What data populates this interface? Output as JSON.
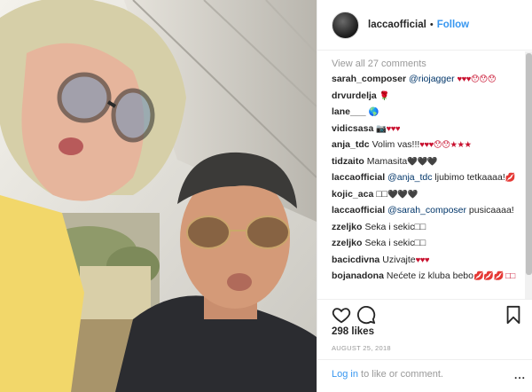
{
  "post": {
    "username": "laccaofficial",
    "separator": "•",
    "follow_label": "Follow",
    "view_all": "View all 27 comments",
    "likes": "298 likes",
    "date": "AUGUST 25, 2018",
    "login_link": "Log in",
    "login_rest": " to like or comment.",
    "more_label": "..."
  },
  "comments": [
    {
      "user": "sarah_composer",
      "mention": "@riojagger",
      "text": "",
      "emoji": "♥♥♥😯😯😯"
    },
    {
      "user": "drvurdelja",
      "mention": "",
      "text": "",
      "emoji": "🌹"
    },
    {
      "user": "lane___",
      "mention": "",
      "text": "",
      "emoji": "🌎"
    },
    {
      "user": "vidicsasa",
      "mention": "",
      "text": "",
      "emoji": "📷♥♥♥"
    },
    {
      "user": "anja_tdc",
      "mention": "",
      "text": "Volim vas!!!",
      "emoji": "♥♥♥😯😯★★★"
    },
    {
      "user": "tidzaito",
      "mention": "",
      "text": "Mamasita",
      "emoji": "🖤🖤🖤"
    },
    {
      "user": "laccaofficial",
      "mention": "@anja_tdc",
      "text": " ljubimo tetkaaaa!",
      "emoji": "💋"
    },
    {
      "user": "kojic_aca",
      "mention": "",
      "text": "□□",
      "emoji": "🖤🖤🖤"
    },
    {
      "user": "laccaofficial",
      "mention": "@sarah_composer",
      "text": " pusicaaaa!",
      "emoji": ""
    },
    {
      "user": "zzeljko",
      "mention": "",
      "text": "Seka i sekic□□",
      "emoji": ""
    },
    {
      "user": "zzeljko",
      "mention": "",
      "text": "Seka i sekic□□",
      "emoji": ""
    },
    {
      "user": "bacicdivna",
      "mention": "",
      "text": "Uzivajte",
      "emoji": "♥♥♥"
    },
    {
      "user": "bojanadona",
      "mention": "",
      "text": "Nećete iz kluba bebo",
      "emoji": "💋💋💋 □□"
    }
  ]
}
